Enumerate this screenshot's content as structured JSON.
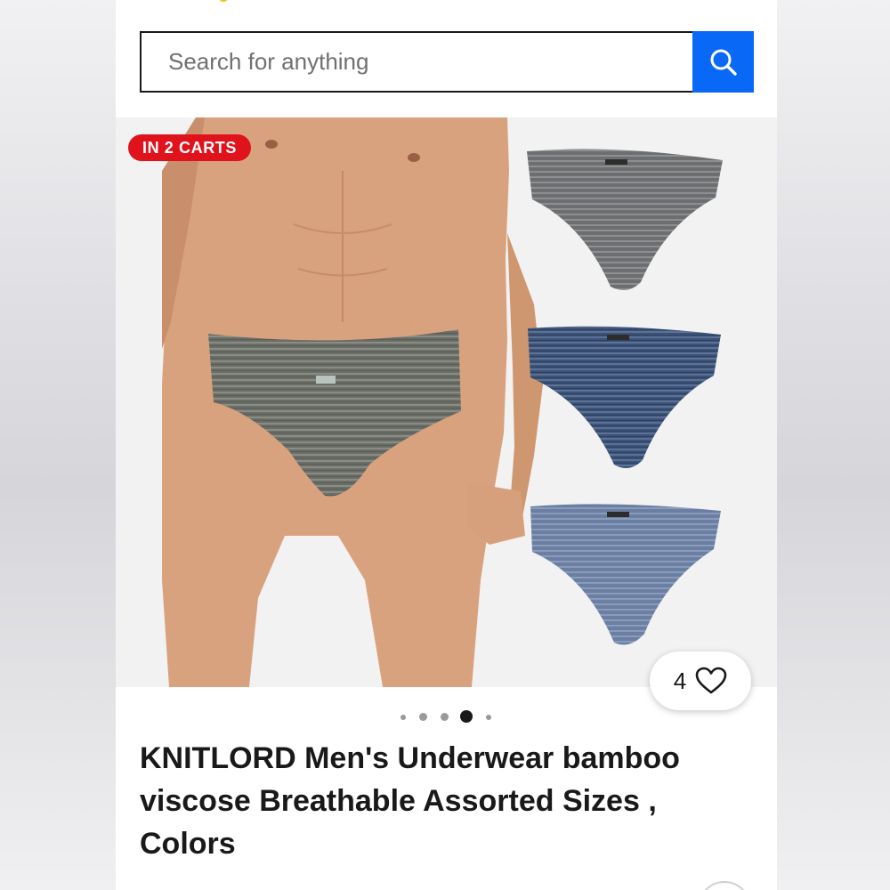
{
  "search": {
    "placeholder": "Search for anything",
    "button_icon": "search-icon",
    "button_color": "#0968f6"
  },
  "listing": {
    "cart_badge": "IN 2 CARTS",
    "badge_color": "#e0121c",
    "watch_count": "4",
    "watch_icon": "heart-icon",
    "image_count": 5,
    "active_image_index": 3,
    "title": "KNITLORD Men's Underwear bamboo viscose Breathable Assorted Sizes , Colors"
  },
  "product_image": {
    "description_visible": false,
    "colors": {
      "gray_brief": "#6d7069",
      "navy_brief": "#3e5578",
      "blue_brief": "#6c80a3",
      "skin": "#d9a27e"
    }
  }
}
